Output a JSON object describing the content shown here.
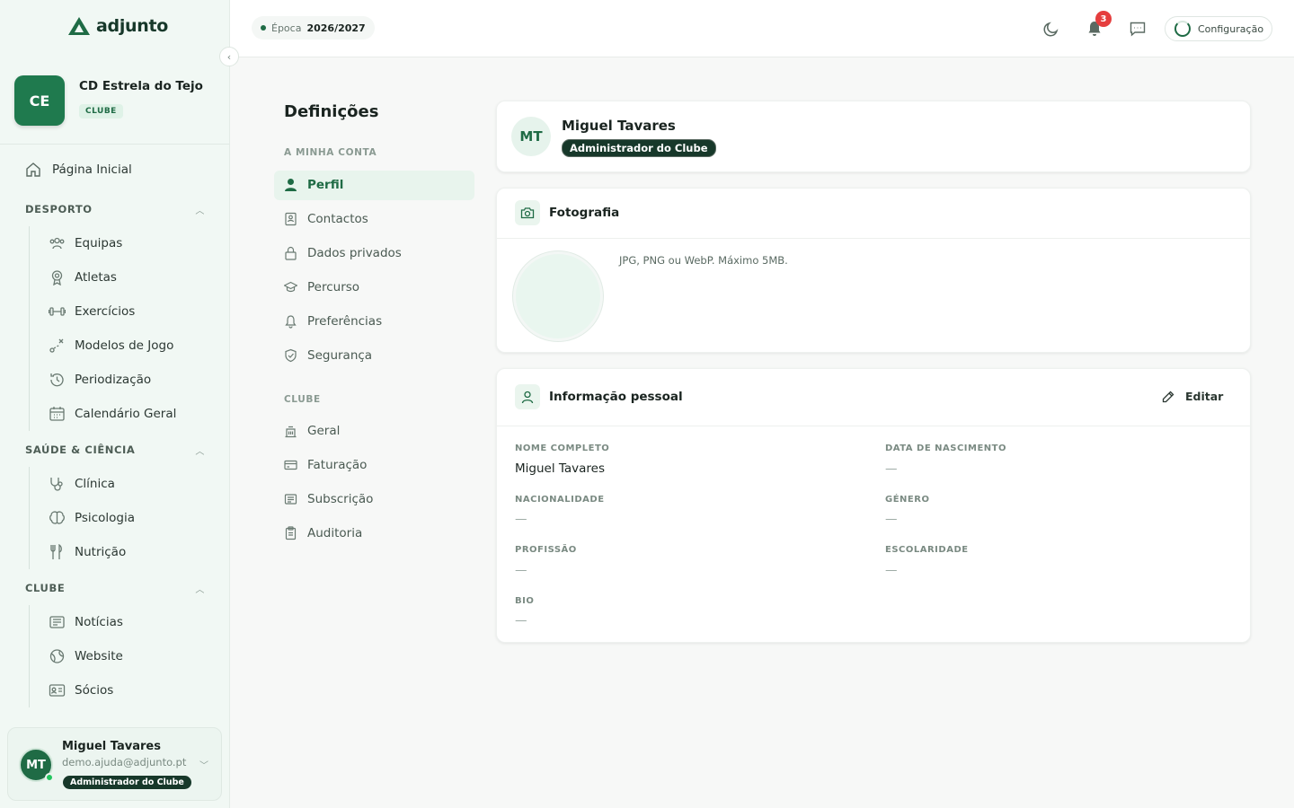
{
  "brand": {
    "name": "adjunto"
  },
  "club": {
    "initials": "CE",
    "name": "CD Estrela do Tejo",
    "tag": "CLUBE"
  },
  "sidebar": {
    "home": "Página Inicial",
    "sections": [
      {
        "title": "DESPORTO",
        "items": [
          "Equipas",
          "Atletas",
          "Exercícios",
          "Modelos de Jogo",
          "Periodização",
          "Calendário Geral"
        ]
      },
      {
        "title": "SAÚDE & CIÊNCIA",
        "items": [
          "Clínica",
          "Psicologia",
          "Nutrição"
        ]
      },
      {
        "title": "CLUBE",
        "items": [
          "Notícias",
          "Website",
          "Sócios"
        ]
      }
    ]
  },
  "user": {
    "initials": "MT",
    "name": "Miguel Tavares",
    "email": "demo.ajuda@adjunto.pt",
    "role": "Administrador do Clube"
  },
  "topbar": {
    "season_label": "Época",
    "season_value": "2026/2027",
    "notifications": "3",
    "config_label": "Configuração"
  },
  "settings": {
    "title": "Definições",
    "account_section": "A MINHA CONTA",
    "account_items": [
      "Perfil",
      "Contactos",
      "Dados privados",
      "Percurso",
      "Preferências",
      "Segurança"
    ],
    "club_section": "CLUBE",
    "club_items": [
      "Geral",
      "Faturação",
      "Subscrição",
      "Auditoria"
    ]
  },
  "profile": {
    "initials": "MT",
    "name": "Miguel Tavares",
    "role": "Administrador do Clube"
  },
  "photo": {
    "title": "Fotografia",
    "hint": "JPG, PNG ou WebP. Máximo 5MB."
  },
  "personal": {
    "title": "Informação pessoal",
    "edit": "Editar",
    "fields": {
      "full_name": {
        "label": "NOME COMPLETO",
        "value": "Miguel Tavares"
      },
      "birth_date": {
        "label": "DATA DE NASCIMENTO",
        "value": "—"
      },
      "nationality": {
        "label": "NACIONALIDADE",
        "value": "—"
      },
      "gender": {
        "label": "GÉNERO",
        "value": "—"
      },
      "profession": {
        "label": "PROFISSÃO",
        "value": "—"
      },
      "education": {
        "label": "ESCOLARIDADE",
        "value": "—"
      },
      "bio": {
        "label": "BIO",
        "value": "—"
      }
    }
  },
  "colors": {
    "brand_green": "#1f6b45",
    "dark_green": "#17382a",
    "badge_red": "#e53e3e"
  }
}
